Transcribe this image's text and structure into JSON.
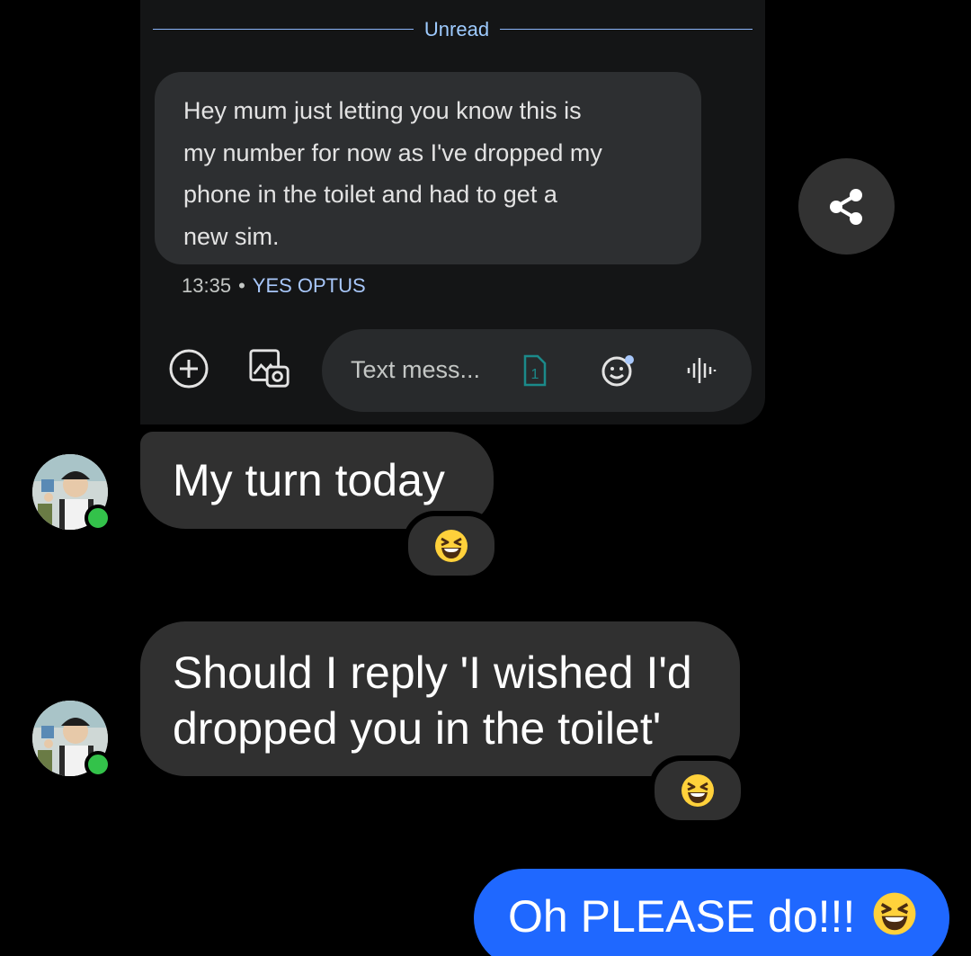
{
  "screenshot": {
    "unread_label": "Unread",
    "message_text": "Hey mum just letting you know this is my number for now as I've dropped my phone in the toilet and had to get a new sim.",
    "message_lines": [
      "Hey mum just letting you know this is",
      "my number for now as I've dropped my",
      "phone in the toilet and had to get a",
      "new sim."
    ],
    "time": "13:35",
    "separator": "•",
    "carrier": "YES OPTUS",
    "composer": {
      "placeholder": "Text mess...",
      "sim_slot": "1",
      "icons": [
        "add-icon",
        "gallery-icon",
        "emoji-icon",
        "voice-icon"
      ]
    }
  },
  "share": {
    "icon": "share-icon"
  },
  "messages": [
    {
      "sender": "contact",
      "text": "My turn today",
      "reaction": "laughing-emoji"
    },
    {
      "sender": "contact",
      "text_lines": [
        "Should I reply 'I wished I'd",
        "dropped you in the toilet'"
      ],
      "reaction": "laughing-emoji"
    },
    {
      "sender": "me",
      "text": "Oh PLEASE do!!!",
      "emoji": "laughing-emoji"
    }
  ],
  "colors": {
    "background": "#000000",
    "incoming_bubble": "#303030",
    "outgoing_bubble": "#1f68ff",
    "online_dot": "#33c24a",
    "accent_blue": "#a8c7fa"
  }
}
